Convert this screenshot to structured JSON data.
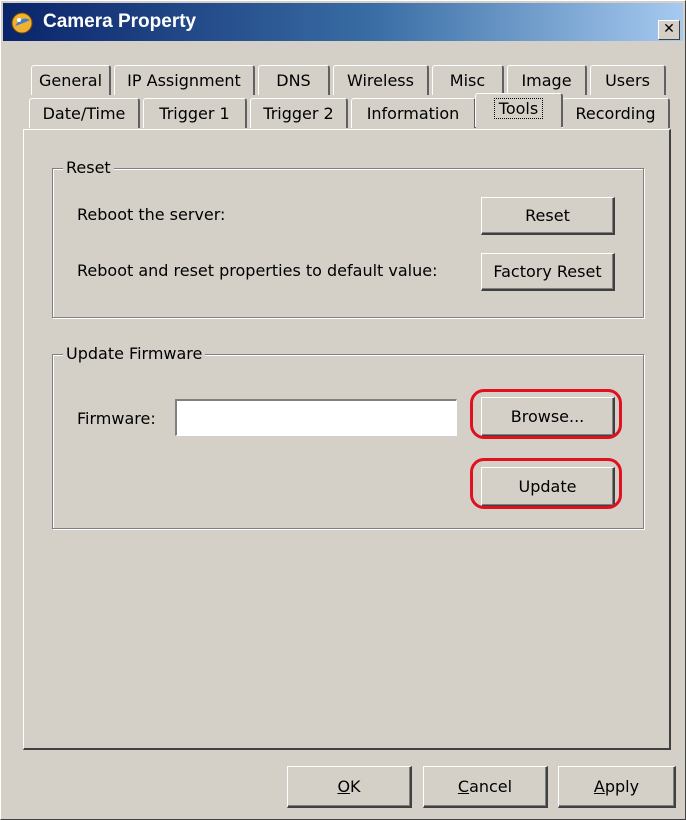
{
  "window": {
    "title": "Camera Property",
    "close_symbol": "✕",
    "icon": "camera-app-icon"
  },
  "tabs": {
    "row_back": [
      "General",
      "IP Assignment",
      "DNS",
      "Wireless",
      "Misc",
      "Image",
      "Users"
    ],
    "row_front": [
      "Date/Time",
      "Trigger 1",
      "Trigger 2",
      "Information",
      "Tools",
      "Recording"
    ],
    "active": "Tools"
  },
  "reset_group": {
    "title": "Reset",
    "reboot_label": "Reboot the server:",
    "reset_button": "Reset",
    "factory_label": "Reboot and reset properties to default value:",
    "factory_button": "Factory Reset"
  },
  "firmware_group": {
    "title": "Update Firmware",
    "firmware_label": "Firmware:",
    "firmware_value": "",
    "browse_button": "Browse...",
    "update_button": "Update"
  },
  "footer": {
    "ok": {
      "mnemonic": "O",
      "rest": "K"
    },
    "cancel": {
      "mnemonic": "C",
      "rest": "ancel"
    },
    "apply": {
      "mnemonic": "A",
      "rest": "pply"
    }
  },
  "colors": {
    "highlight": "#e0101e",
    "titlebar_start": "#0a246a",
    "titlebar_end": "#a6caf0",
    "face": "#d4d0c8"
  }
}
